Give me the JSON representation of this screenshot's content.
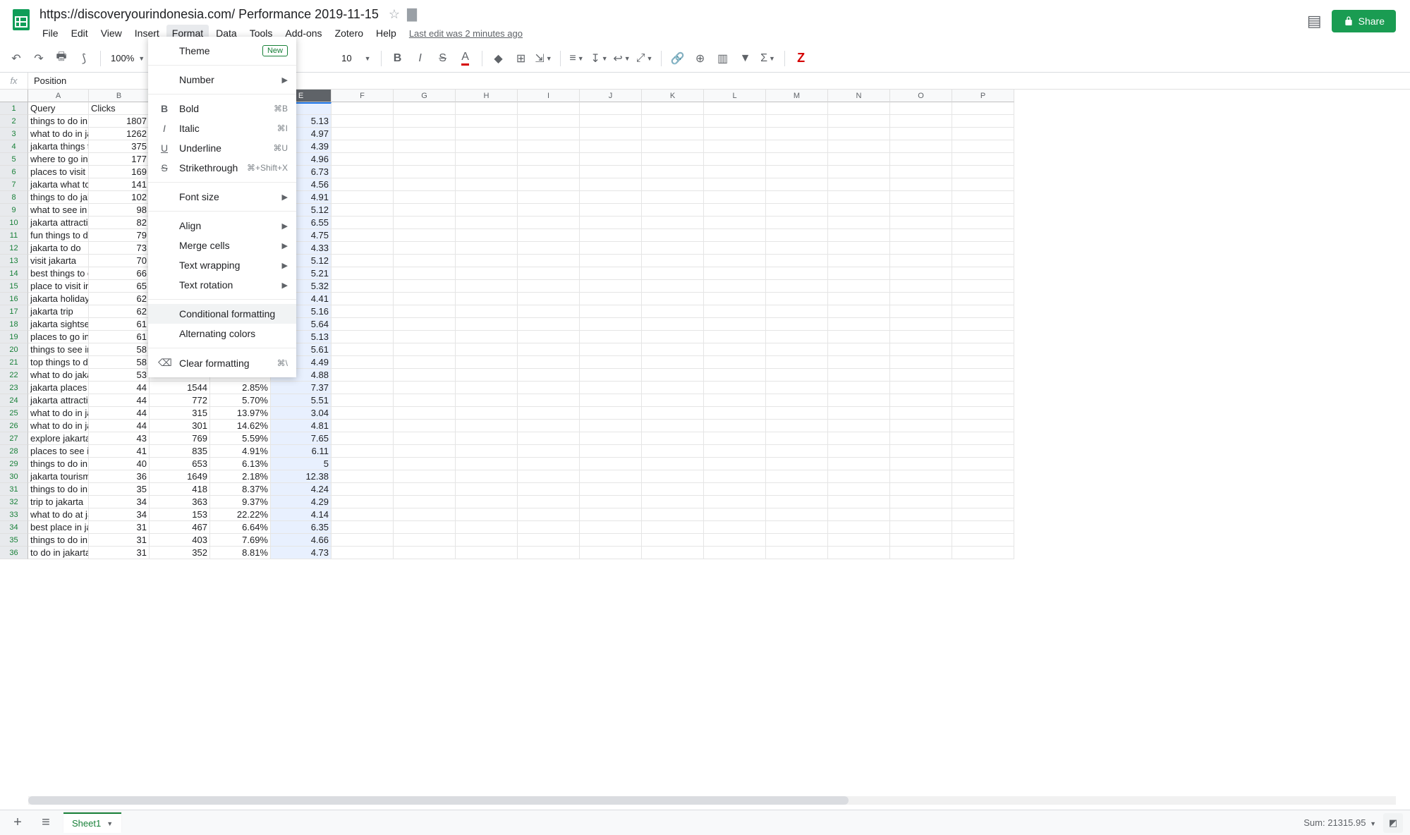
{
  "doc_title": "https://discoveryourindonesia.com/ Performance 2019-11-15",
  "menubar": [
    "File",
    "Edit",
    "View",
    "Insert",
    "Format",
    "Data",
    "Tools",
    "Add-ons",
    "Zotero",
    "Help"
  ],
  "last_edit": "Last edit was 2 minutes ago",
  "share_label": "Share",
  "toolbar": {
    "zoom": "100%",
    "font_size": "10"
  },
  "formula_bar": {
    "fx": "fx",
    "value": "Position"
  },
  "columns": [
    "A",
    "B",
    "C",
    "D",
    "E",
    "F",
    "G",
    "H",
    "I",
    "J",
    "K",
    "L",
    "M",
    "N",
    "O",
    "P"
  ],
  "selected_column": "E",
  "header_row": {
    "A": "Query",
    "B": "Clicks",
    "E_partial": "n"
  },
  "rows": [
    {
      "A": "things to do in jak",
      "B": "1807",
      "E": "5.13"
    },
    {
      "A": "what to do in jaka",
      "B": "1262",
      "E": "4.97"
    },
    {
      "A": "jakarta things to d",
      "B": "375",
      "E": "4.39"
    },
    {
      "A": "where to go in jak",
      "B": "177",
      "E": "4.96"
    },
    {
      "A": "places to visit in j",
      "B": "169",
      "E": "6.73"
    },
    {
      "A": "jakarta what to do",
      "B": "141",
      "E": "4.56"
    },
    {
      "A": "things to do jakar",
      "B": "102",
      "E": "4.91"
    },
    {
      "A": "what to see in jak",
      "B": "98",
      "E": "5.12"
    },
    {
      "A": "jakarta attractions",
      "B": "82",
      "E": "6.55"
    },
    {
      "A": "fun things to do in",
      "B": "79",
      "E": "4.75"
    },
    {
      "A": "jakarta to do",
      "B": "73",
      "E": "4.33"
    },
    {
      "A": "visit jakarta",
      "B": "70",
      "E": "5.12"
    },
    {
      "A": "best things to do",
      "B": "66",
      "E": "5.21"
    },
    {
      "A": "place to visit in ja",
      "B": "65",
      "E": "5.32"
    },
    {
      "A": "jakarta holiday",
      "B": "62",
      "E": "4.41"
    },
    {
      "A": "jakarta trip",
      "B": "62",
      "E": "5.16"
    },
    {
      "A": "jakarta sightseein",
      "B": "61",
      "E": "5.64"
    },
    {
      "A": "places to go in ja",
      "B": "61",
      "E": "5.13"
    },
    {
      "A": "things to see in ja",
      "B": "58",
      "E": "5.61"
    },
    {
      "A": "top things to do in",
      "B": "58",
      "E": "4.49"
    },
    {
      "A": "what to do jakarta",
      "B": "53",
      "E": "4.88"
    },
    {
      "A": "jakarta places to",
      "B": "44",
      "C": "1544",
      "D": "2.85%",
      "E": "7.37"
    },
    {
      "A": "jakarta attraction",
      "B": "44",
      "C": "772",
      "D": "5.70%",
      "E": "5.51"
    },
    {
      "A": "what to do in jaka",
      "B": "44",
      "C": "315",
      "D": "13.97%",
      "E": "3.04"
    },
    {
      "A": "what to do in jaka",
      "B": "44",
      "C": "301",
      "D": "14.62%",
      "E": "4.81"
    },
    {
      "A": "explore jakarta",
      "B": "43",
      "C": "769",
      "D": "5.59%",
      "E": "7.65"
    },
    {
      "A": "places to see in ja",
      "B": "41",
      "C": "835",
      "D": "4.91%",
      "E": "6.11"
    },
    {
      "A": "things to do in jak",
      "B": "40",
      "C": "653",
      "D": "6.13%",
      "E": "5"
    },
    {
      "A": "jakarta tourism",
      "B": "36",
      "C": "1649",
      "D": "2.18%",
      "E": "12.38"
    },
    {
      "A": "things to do in jak",
      "B": "35",
      "C": "418",
      "D": "8.37%",
      "E": "4.24"
    },
    {
      "A": "trip to jakarta",
      "B": "34",
      "C": "363",
      "D": "9.37%",
      "E": "4.29"
    },
    {
      "A": "what to do at jaka",
      "B": "34",
      "C": "153",
      "D": "22.22%",
      "E": "4.14"
    },
    {
      "A": "best place in jaka",
      "B": "31",
      "C": "467",
      "D": "6.64%",
      "E": "6.35"
    },
    {
      "A": "things to do in jak",
      "B": "31",
      "C": "403",
      "D": "7.69%",
      "E": "4.66"
    },
    {
      "A": "to do in jakarta",
      "B": "31",
      "C": "352",
      "D": "8.81%",
      "E": "4.73"
    }
  ],
  "format_menu": {
    "sections": [
      [
        {
          "label": "Theme",
          "badge": "New"
        }
      ],
      [
        {
          "label": "Number",
          "arrow": true
        }
      ],
      [
        {
          "icon": "B",
          "label": "Bold",
          "shortcut": "⌘B"
        },
        {
          "icon": "I",
          "label": "Italic",
          "shortcut": "⌘I",
          "italic": true
        },
        {
          "icon": "U",
          "label": "Underline",
          "shortcut": "⌘U"
        },
        {
          "icon": "S",
          "label": "Strikethrough",
          "shortcut": "⌘+Shift+X"
        }
      ],
      [
        {
          "label": "Font size",
          "arrow": true
        }
      ],
      [
        {
          "label": "Align",
          "arrow": true
        },
        {
          "label": "Merge cells",
          "arrow": true
        },
        {
          "label": "Text wrapping",
          "arrow": true
        },
        {
          "label": "Text rotation",
          "arrow": true
        }
      ],
      [
        {
          "label": "Conditional formatting",
          "hovered": true
        },
        {
          "label": "Alternating colors"
        }
      ],
      [
        {
          "icon": "⌫",
          "label": "Clear formatting",
          "shortcut": "⌘\\"
        }
      ]
    ]
  },
  "tab_bar": {
    "sheet": "Sheet1",
    "sum": "Sum: 21315.95"
  }
}
